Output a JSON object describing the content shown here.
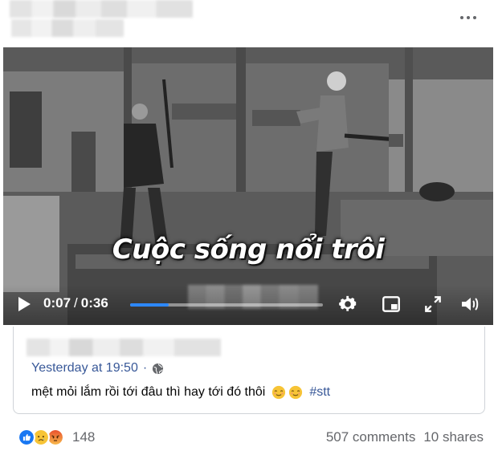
{
  "video": {
    "overlay_title": "Cuộc sống nổi trôi",
    "current_time": "0:07",
    "separator": "/",
    "duration": "0:36",
    "progress_fraction": 0.2
  },
  "shared_post": {
    "timestamp": "Yesterday at 19:50",
    "dot": "·",
    "text": "mệt mỏi lắm rồi tới đâu thì hay tới đó thôi",
    "hashtag": "#stt"
  },
  "footer": {
    "reaction_count": "148",
    "comments": "507 comments",
    "shares": "10 shares"
  },
  "icons": [
    "more-icon",
    "play-icon",
    "gear-icon",
    "miniplayer-icon",
    "fullscreen-icon",
    "volume-icon",
    "globe-icon",
    "like-reaction-icon",
    "sad-reaction-icon",
    "angry-reaction-icon",
    "relieved-emoji-icon"
  ],
  "colors": {
    "link": "#385898",
    "progress": "#2d88ff",
    "muted": "#65676b"
  }
}
